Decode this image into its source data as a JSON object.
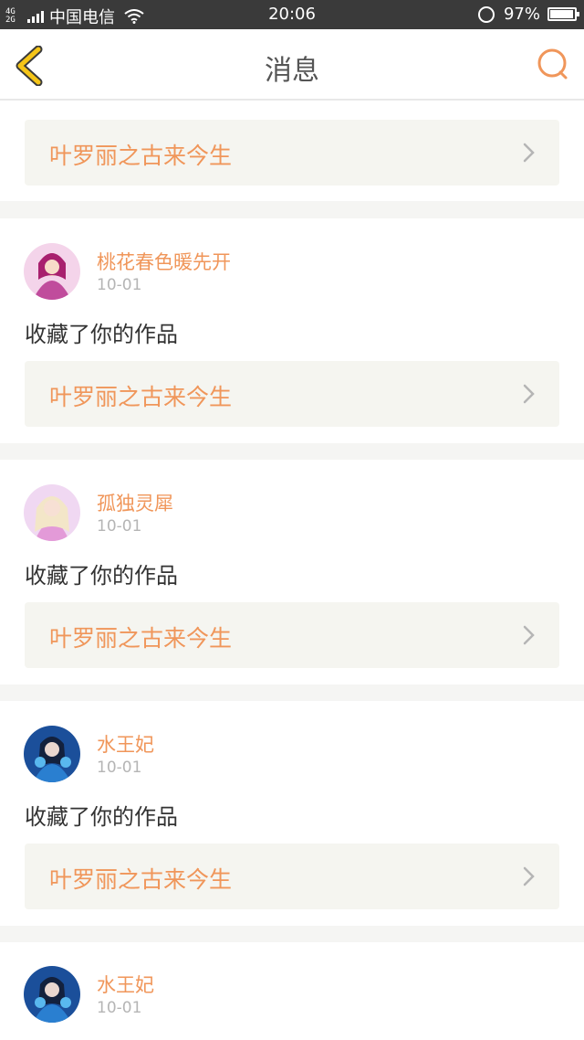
{
  "status_bar": {
    "network": "4G 2G",
    "carrier": "中国电信",
    "time": "20:06",
    "battery_percent": "97%",
    "battery_level": 0.97
  },
  "nav": {
    "title": "消息",
    "back_icon": "chevron-left-icon",
    "search_icon": "search-icon",
    "accent_color": "#f0965a",
    "back_color": "#f5c518"
  },
  "first_item": {
    "work_title": "叶罗丽之古来今生"
  },
  "messages": [
    {
      "user": "桃花春色暖先开",
      "date": "10-01",
      "action": "收藏了你的作品",
      "work_title": "叶罗丽之古来今生",
      "avatar_color": "#c04c9c"
    },
    {
      "user": "孤独灵犀",
      "date": "10-01",
      "action": "收藏了你的作品",
      "work_title": "叶罗丽之古来今生",
      "avatar_color": "#e39ad8"
    },
    {
      "user": "水王妃",
      "date": "10-01",
      "action": "收藏了你的作品",
      "work_title": "叶罗丽之古来今生",
      "avatar_color": "#2a7fd0"
    },
    {
      "user": "水王妃",
      "date": "10-01"
    }
  ]
}
